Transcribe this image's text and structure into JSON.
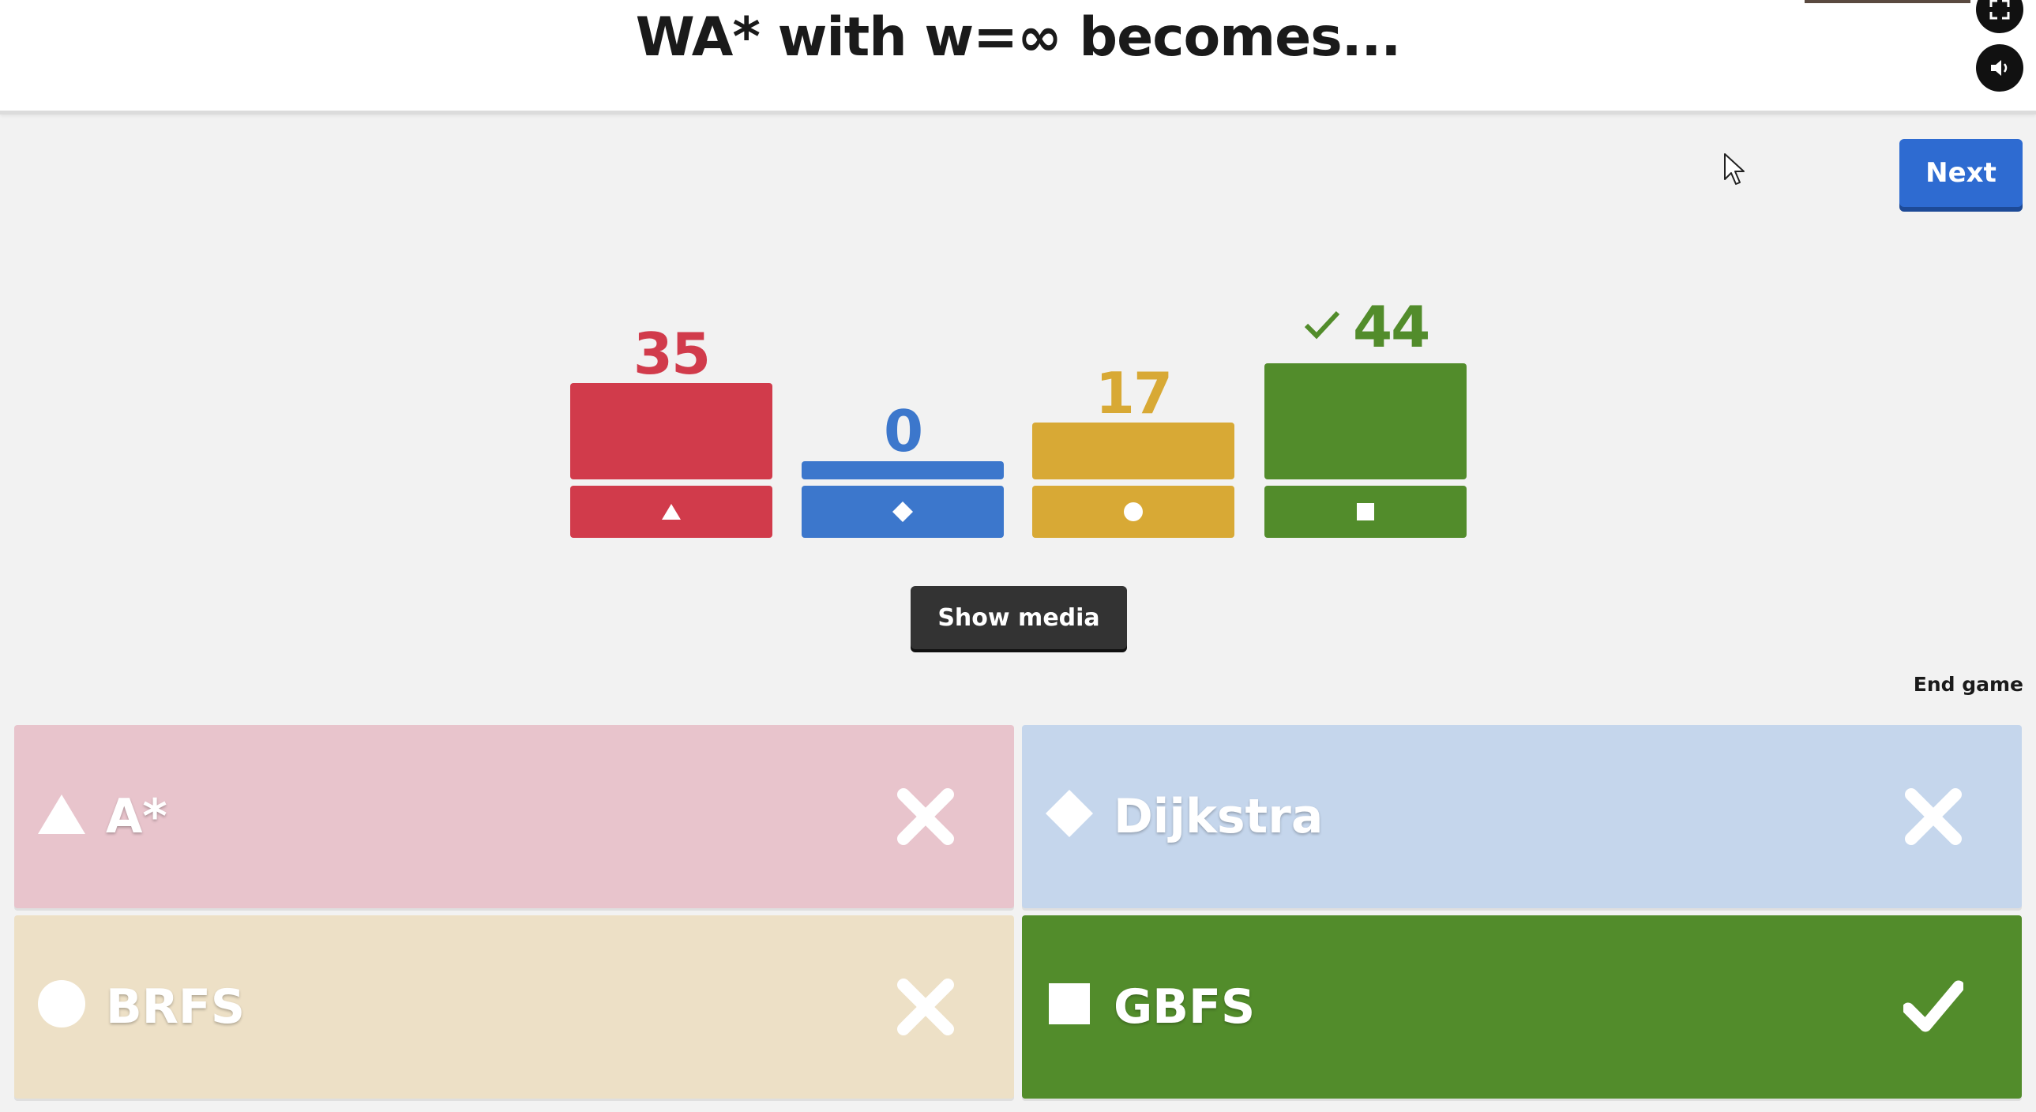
{
  "header": {
    "question": "WA* with w=∞ becomes...",
    "fullscreen_icon": "fullscreen-icon",
    "sound_icon": "speaker-icon"
  },
  "controls": {
    "next_label": "Next",
    "show_media_label": "Show media",
    "end_game_label": "End game"
  },
  "colors": {
    "red": "#d13b4b",
    "blue": "#3c77cc",
    "yellow": "#d8a935",
    "green": "#528c2b"
  },
  "results": [
    {
      "shape": "triangle",
      "count": "35",
      "correct": false
    },
    {
      "shape": "diamond",
      "count": "0",
      "correct": false
    },
    {
      "shape": "circle",
      "count": "17",
      "correct": false
    },
    {
      "shape": "square",
      "count": "44",
      "correct": true
    }
  ],
  "answers": [
    {
      "shape": "triangle-icon",
      "label": "A*",
      "result_icon": "cross-icon",
      "correct": false
    },
    {
      "shape": "diamond-icon",
      "label": "Dijkstra",
      "result_icon": "cross-icon",
      "correct": false
    },
    {
      "shape": "circle-icon",
      "label": "BRFS",
      "result_icon": "cross-icon",
      "correct": false
    },
    {
      "shape": "square-icon",
      "label": "GBFS",
      "result_icon": "checkmark-icon",
      "correct": true
    }
  ]
}
